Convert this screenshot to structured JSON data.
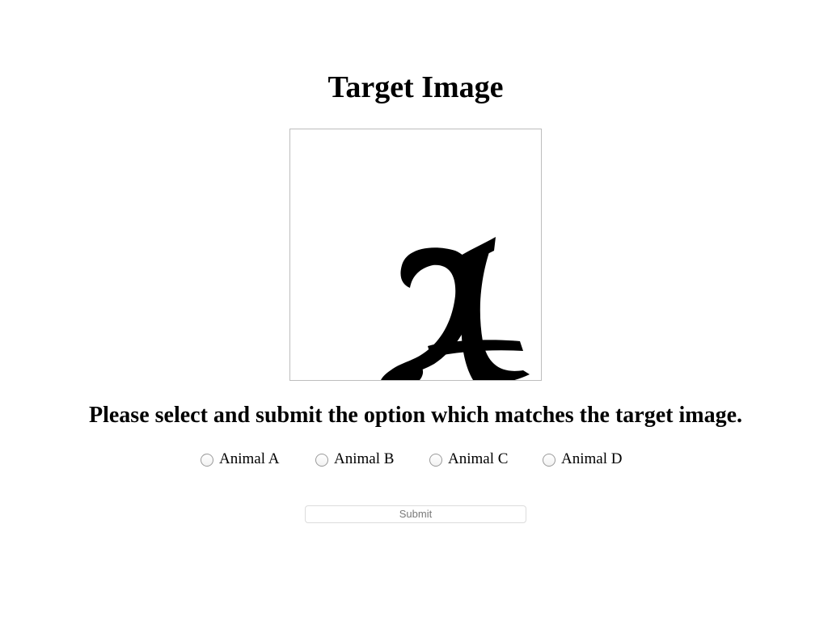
{
  "page": {
    "title": "Target Image",
    "prompt": "Please select and submit the option which matches the target image."
  },
  "target_image": {
    "glyph": "A",
    "glyph_style": "blackletter",
    "glyph_color": "#000000"
  },
  "options": [
    {
      "label": "Animal A",
      "selected": false
    },
    {
      "label": "Animal B",
      "selected": false
    },
    {
      "label": "Animal C",
      "selected": false
    },
    {
      "label": "Animal D",
      "selected": false
    }
  ],
  "submit": {
    "label": "Submit",
    "disabled": true
  }
}
